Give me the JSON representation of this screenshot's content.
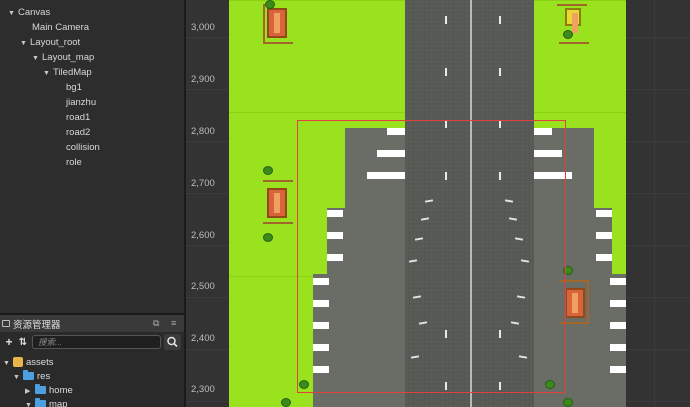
{
  "hierarchy": {
    "items": [
      {
        "label": "Canvas",
        "expanded": true
      },
      {
        "label": "Main Camera"
      },
      {
        "label": "Layout_root",
        "expanded": true
      },
      {
        "label": "Layout_map",
        "expanded": true
      },
      {
        "label": "TiledMap",
        "expanded": true
      },
      {
        "label": "bg1"
      },
      {
        "label": "jianzhu"
      },
      {
        "label": "road1"
      },
      {
        "label": "road2"
      },
      {
        "label": "collision"
      },
      {
        "label": "role"
      }
    ]
  },
  "assets": {
    "title": "资源管理器",
    "search_placeholder": "搜索...",
    "tree": [
      {
        "label": "assets"
      },
      {
        "label": "res"
      },
      {
        "label": "home"
      },
      {
        "label": "map"
      }
    ]
  },
  "scene": {
    "ruler_labels": [
      "3,000",
      "2,900",
      "2,800",
      "2,700",
      "2,600",
      "2,500",
      "2,400",
      "2,300"
    ],
    "colors": {
      "grass": "#9be21e",
      "road": "#575955",
      "selection": "#e04040"
    }
  },
  "icons": [
    "chevron-down-icon",
    "chevron-right-icon",
    "plus-icon",
    "sort-icon",
    "search-icon",
    "folder-icon",
    "maximize-icon",
    "menu-icon"
  ]
}
